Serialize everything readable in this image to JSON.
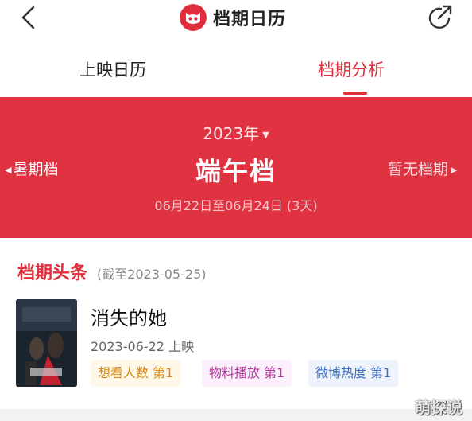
{
  "header": {
    "title": "档期日历",
    "icons": {
      "back": "chevron-left-icon",
      "share": "share-icon",
      "logo": "maoyan-cat-logo"
    }
  },
  "tabs": [
    {
      "label": "上映日历",
      "active": false
    },
    {
      "label": "档期分析",
      "active": true
    }
  ],
  "banner": {
    "year": "2023年",
    "period": "端午档",
    "range": "06月22日至06月24日 (3天)",
    "prev_period": "暑期档",
    "next_period": "暂无档期",
    "background_color": "#e03341"
  },
  "headline": {
    "title": "档期头条",
    "subtitle": "(截至2023-05-25)",
    "movie": {
      "title": "消失的她",
      "release": "2023-06-22 上映",
      "tags": [
        {
          "label": "想看人数 第1"
        },
        {
          "label": "物料播放 第1"
        },
        {
          "label": "微博热度 第1"
        }
      ]
    }
  },
  "watermark": "萌探说",
  "colors": {
    "accent": "#e02e3c"
  }
}
